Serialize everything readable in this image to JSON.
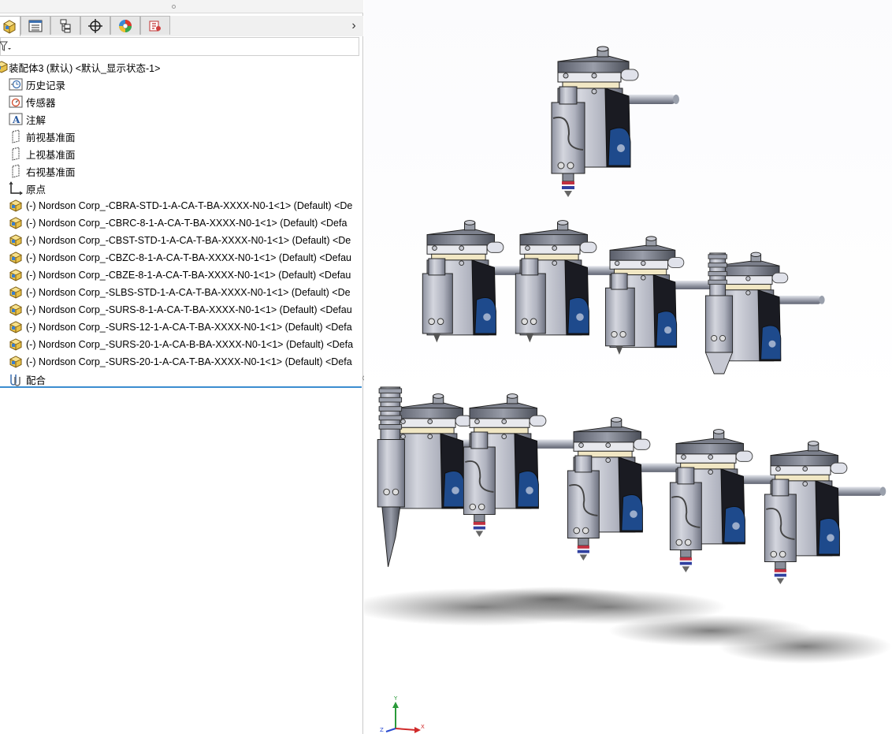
{
  "tabs": [
    {
      "name": "feature-manager-tab",
      "icon": "assembly-cube-icon",
      "active": true
    },
    {
      "name": "property-manager-tab",
      "icon": "property-list-icon",
      "active": false
    },
    {
      "name": "configuration-manager-tab",
      "icon": "configuration-icon",
      "active": false
    },
    {
      "name": "dimxpert-manager-tab",
      "icon": "crosshair-target-icon",
      "active": false
    },
    {
      "name": "display-manager-tab",
      "icon": "appearance-color-wheel-icon",
      "active": false
    },
    {
      "name": "cam-tab",
      "icon": "cam-icon",
      "active": false
    }
  ],
  "tab_more": "›",
  "tree": {
    "root": "装配体3 (默认) <默认_显示状态-1>",
    "items": [
      {
        "label": "历史记录",
        "icon": "history-icon"
      },
      {
        "label": "传感器",
        "icon": "sensor-icon"
      },
      {
        "label": "注解",
        "icon": "annotation-icon"
      },
      {
        "label": "前视基准面",
        "icon": "plane-icon"
      },
      {
        "label": "上视基准面",
        "icon": "plane-icon"
      },
      {
        "label": "右视基准面",
        "icon": "plane-icon"
      },
      {
        "label": "原点",
        "icon": "origin-icon"
      },
      {
        "label": "(-) Nordson Corp_-CBRA-STD-1-A-CA-T-BA-XXXX-N0-1<1> (Default) <De",
        "icon": "part-icon"
      },
      {
        "label": "(-) Nordson Corp_-CBRC-8-1-A-CA-T-BA-XXXX-N0-1<1> (Default) <Defa",
        "icon": "part-icon"
      },
      {
        "label": "(-) Nordson Corp_-CBST-STD-1-A-CA-T-BA-XXXX-N0-1<1> (Default) <De",
        "icon": "part-icon"
      },
      {
        "label": "(-) Nordson Corp_-CBZC-8-1-A-CA-T-BA-XXXX-N0-1<1> (Default) <Defau",
        "icon": "part-icon"
      },
      {
        "label": "(-) Nordson Corp_-CBZE-8-1-A-CA-T-BA-XXXX-N0-1<1> (Default) <Defau",
        "icon": "part-icon"
      },
      {
        "label": "(-) Nordson Corp_-SLBS-STD-1-A-CA-T-BA-XXXX-N0-1<1> (Default) <De",
        "icon": "part-icon"
      },
      {
        "label": "(-) Nordson Corp_-SURS-8-1-A-CA-T-BA-XXXX-N0-1<1> (Default) <Defau",
        "icon": "part-icon"
      },
      {
        "label": "(-) Nordson Corp_-SURS-12-1-A-CA-T-BA-XXXX-N0-1<1> (Default) <Defa",
        "icon": "part-icon"
      },
      {
        "label": "(-) Nordson Corp_-SURS-20-1-A-CA-B-BA-XXXX-N0-1<1> (Default) <Defa",
        "icon": "part-icon"
      },
      {
        "label": "(-) Nordson Corp_-SURS-20-1-A-CA-T-BA-XXXX-N0-1<1> (Default) <Defa",
        "icon": "part-icon"
      },
      {
        "label": "配合",
        "icon": "mates-icon"
      }
    ]
  },
  "triad": {
    "x": "X",
    "y": "Y",
    "z": "Z"
  },
  "colors": {
    "accent": "#3c8dd0",
    "part_blue": "#1e4a8c",
    "part_steel": "#b5b8c4"
  }
}
